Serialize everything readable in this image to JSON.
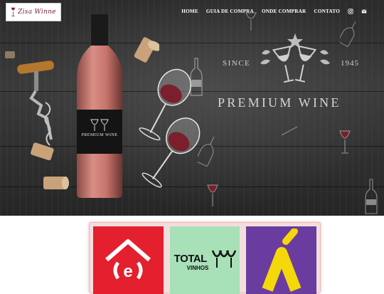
{
  "brand": {
    "logo_text": "Zisa Winne"
  },
  "nav": {
    "items": [
      {
        "label": "HOME"
      },
      {
        "label": "GUIA DE COMPRA"
      },
      {
        "label": "ONDE COMPRAR"
      },
      {
        "label": "CONTATO"
      }
    ],
    "icons": [
      "instagram-icon",
      "email-icon"
    ]
  },
  "hero": {
    "since_label": "SINCE",
    "year": "1945",
    "headline": "PREMIUM WINE",
    "bottle_label": "PREMIUM WINE"
  },
  "partners": [
    {
      "name": "(e)",
      "color": "#e4202e"
    },
    {
      "name": "TOTAL",
      "subtitle": "VINHOS",
      "color": "#a8e0b8"
    },
    {
      "name": "á",
      "color": "#6a3ca0"
    }
  ],
  "colors": {
    "hero_bg": "#2e2e2e",
    "wine": "#7a1f2b",
    "rose": "#d98e86"
  }
}
